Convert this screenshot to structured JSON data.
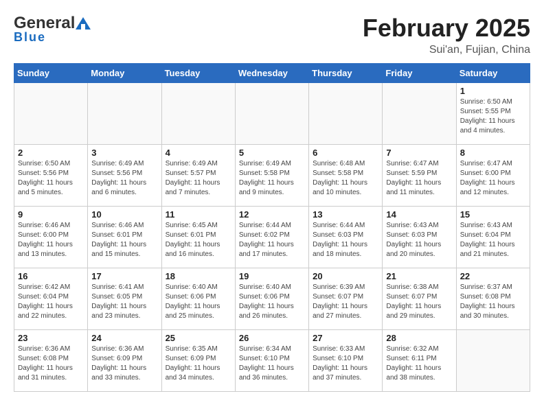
{
  "header": {
    "logo_general": "General",
    "logo_blue": "Blue",
    "month": "February 2025",
    "location": "Sui'an, Fujian, China"
  },
  "weekdays": [
    "Sunday",
    "Monday",
    "Tuesday",
    "Wednesday",
    "Thursday",
    "Friday",
    "Saturday"
  ],
  "weeks": [
    [
      {
        "day": "",
        "info": ""
      },
      {
        "day": "",
        "info": ""
      },
      {
        "day": "",
        "info": ""
      },
      {
        "day": "",
        "info": ""
      },
      {
        "day": "",
        "info": ""
      },
      {
        "day": "",
        "info": ""
      },
      {
        "day": "1",
        "info": "Sunrise: 6:50 AM\nSunset: 5:55 PM\nDaylight: 11 hours\nand 4 minutes."
      }
    ],
    [
      {
        "day": "2",
        "info": "Sunrise: 6:50 AM\nSunset: 5:56 PM\nDaylight: 11 hours\nand 5 minutes."
      },
      {
        "day": "3",
        "info": "Sunrise: 6:49 AM\nSunset: 5:56 PM\nDaylight: 11 hours\nand 6 minutes."
      },
      {
        "day": "4",
        "info": "Sunrise: 6:49 AM\nSunset: 5:57 PM\nDaylight: 11 hours\nand 7 minutes."
      },
      {
        "day": "5",
        "info": "Sunrise: 6:49 AM\nSunset: 5:58 PM\nDaylight: 11 hours\nand 9 minutes."
      },
      {
        "day": "6",
        "info": "Sunrise: 6:48 AM\nSunset: 5:58 PM\nDaylight: 11 hours\nand 10 minutes."
      },
      {
        "day": "7",
        "info": "Sunrise: 6:47 AM\nSunset: 5:59 PM\nDaylight: 11 hours\nand 11 minutes."
      },
      {
        "day": "8",
        "info": "Sunrise: 6:47 AM\nSunset: 6:00 PM\nDaylight: 11 hours\nand 12 minutes."
      }
    ],
    [
      {
        "day": "9",
        "info": "Sunrise: 6:46 AM\nSunset: 6:00 PM\nDaylight: 11 hours\nand 13 minutes."
      },
      {
        "day": "10",
        "info": "Sunrise: 6:46 AM\nSunset: 6:01 PM\nDaylight: 11 hours\nand 15 minutes."
      },
      {
        "day": "11",
        "info": "Sunrise: 6:45 AM\nSunset: 6:01 PM\nDaylight: 11 hours\nand 16 minutes."
      },
      {
        "day": "12",
        "info": "Sunrise: 6:44 AM\nSunset: 6:02 PM\nDaylight: 11 hours\nand 17 minutes."
      },
      {
        "day": "13",
        "info": "Sunrise: 6:44 AM\nSunset: 6:03 PM\nDaylight: 11 hours\nand 18 minutes."
      },
      {
        "day": "14",
        "info": "Sunrise: 6:43 AM\nSunset: 6:03 PM\nDaylight: 11 hours\nand 20 minutes."
      },
      {
        "day": "15",
        "info": "Sunrise: 6:43 AM\nSunset: 6:04 PM\nDaylight: 11 hours\nand 21 minutes."
      }
    ],
    [
      {
        "day": "16",
        "info": "Sunrise: 6:42 AM\nSunset: 6:04 PM\nDaylight: 11 hours\nand 22 minutes."
      },
      {
        "day": "17",
        "info": "Sunrise: 6:41 AM\nSunset: 6:05 PM\nDaylight: 11 hours\nand 23 minutes."
      },
      {
        "day": "18",
        "info": "Sunrise: 6:40 AM\nSunset: 6:06 PM\nDaylight: 11 hours\nand 25 minutes."
      },
      {
        "day": "19",
        "info": "Sunrise: 6:40 AM\nSunset: 6:06 PM\nDaylight: 11 hours\nand 26 minutes."
      },
      {
        "day": "20",
        "info": "Sunrise: 6:39 AM\nSunset: 6:07 PM\nDaylight: 11 hours\nand 27 minutes."
      },
      {
        "day": "21",
        "info": "Sunrise: 6:38 AM\nSunset: 6:07 PM\nDaylight: 11 hours\nand 29 minutes."
      },
      {
        "day": "22",
        "info": "Sunrise: 6:37 AM\nSunset: 6:08 PM\nDaylight: 11 hours\nand 30 minutes."
      }
    ],
    [
      {
        "day": "23",
        "info": "Sunrise: 6:36 AM\nSunset: 6:08 PM\nDaylight: 11 hours\nand 31 minutes."
      },
      {
        "day": "24",
        "info": "Sunrise: 6:36 AM\nSunset: 6:09 PM\nDaylight: 11 hours\nand 33 minutes."
      },
      {
        "day": "25",
        "info": "Sunrise: 6:35 AM\nSunset: 6:09 PM\nDaylight: 11 hours\nand 34 minutes."
      },
      {
        "day": "26",
        "info": "Sunrise: 6:34 AM\nSunset: 6:10 PM\nDaylight: 11 hours\nand 36 minutes."
      },
      {
        "day": "27",
        "info": "Sunrise: 6:33 AM\nSunset: 6:10 PM\nDaylight: 11 hours\nand 37 minutes."
      },
      {
        "day": "28",
        "info": "Sunrise: 6:32 AM\nSunset: 6:11 PM\nDaylight: 11 hours\nand 38 minutes."
      },
      {
        "day": "",
        "info": ""
      }
    ]
  ]
}
